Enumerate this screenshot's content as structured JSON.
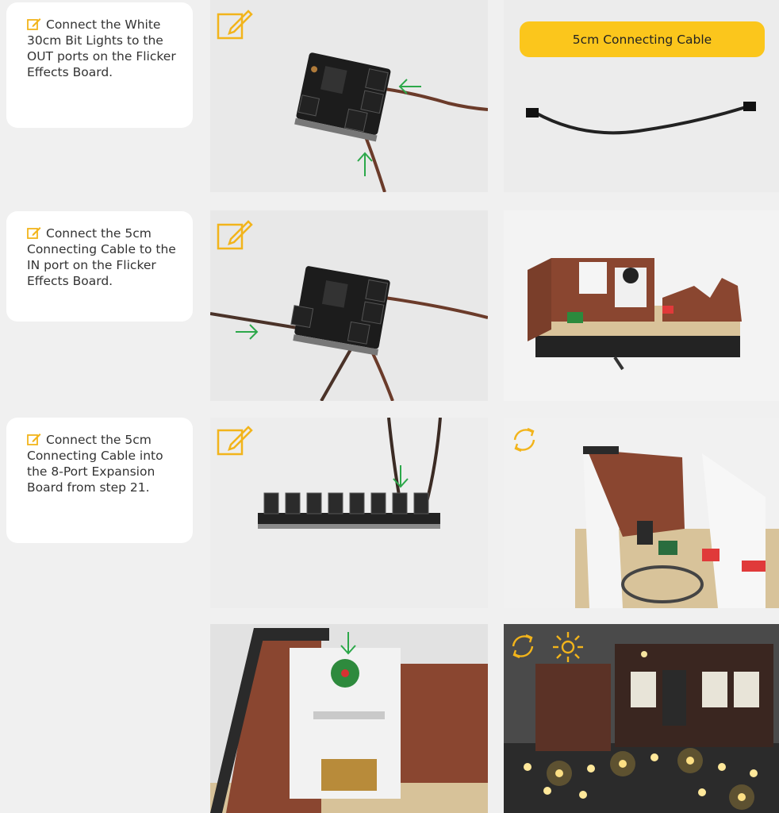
{
  "steps": [
    {
      "text": "Connect the White 30cm Bit Lights to the OUT ports on the Flicker Effects Board."
    },
    {
      "text": "Connect the 5cm Connecting Cable to the IN port on the Flicker Effects Board."
    },
    {
      "text": "Connect the 5cm Connecting Cable into the 8-Port Expansion Board from step 21."
    }
  ],
  "cable_label": "5cm Connecting Cable",
  "colors": {
    "page_bg": "#f0f0f0",
    "accent_yellow": "#fbc61c",
    "arrow_green": "#2ca84a",
    "text": "#333333"
  }
}
